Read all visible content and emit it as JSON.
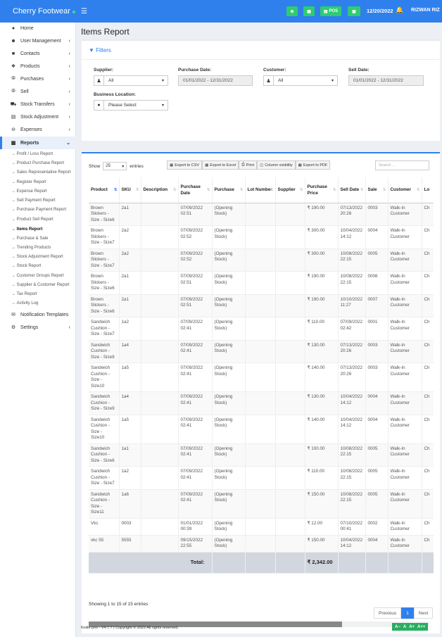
{
  "app": {
    "brand": "Cherry Footwear"
  },
  "topbar": {
    "pos_label": "POS",
    "date": "12/20/2022",
    "user": "RIZWAN RIZ"
  },
  "sidebar": {
    "items": [
      {
        "label": "Home",
        "icon": "dashboard-icon"
      },
      {
        "label": "User Management",
        "icon": "users-icon"
      },
      {
        "label": "Contacts",
        "icon": "address-book-icon"
      },
      {
        "label": "Products",
        "icon": "cubes-icon"
      },
      {
        "label": "Purchases",
        "icon": "arrow-circle-down-icon"
      },
      {
        "label": "Sell",
        "icon": "arrow-circle-up-icon"
      },
      {
        "label": "Stock Transfers",
        "icon": "truck-icon"
      },
      {
        "label": "Stock Adjustment",
        "icon": "database-icon"
      },
      {
        "label": "Expenses",
        "icon": "minus-circle-icon"
      },
      {
        "label": "Reports",
        "icon": "bar-chart-icon"
      }
    ],
    "sub_items": [
      "Profit / Loss Report",
      "Product Purchase Report",
      "Sales Representative Report",
      "Register Report",
      "Expense Report",
      "Sell Payment Report",
      "Purchase Payment Report",
      "Product Sell Report",
      "Items Report",
      "Purchase & Sale",
      "Trending Products",
      "Stock Adjustment Report",
      "Stock Report",
      "Customer Groups Report",
      "Supplier & Customer Report",
      "Tax Report",
      "Activity Log"
    ],
    "bottom_items": [
      {
        "label": "Notification Templates",
        "icon": "envelope-icon"
      },
      {
        "label": "Settings",
        "icon": "cog-icon"
      }
    ]
  },
  "page": {
    "title": "Items Report"
  },
  "filters": {
    "title": "Filters",
    "supplier_label": "Supplier:",
    "supplier_value": "All",
    "purchase_date_label": "Purchase Date:",
    "purchase_date_value": "01/01/2022 - 12/31/2022",
    "customer_label": "Customer:",
    "customer_value": "All",
    "sell_date_label": "Sell Date:",
    "sell_date_value": "01/01/2022 - 12/31/2022",
    "location_label": "Business Location:",
    "location_value": "Please Select"
  },
  "table": {
    "show_label": "Show",
    "entries_value": "25",
    "entries_label": "entries",
    "export_csv": "Export to CSV",
    "export_excel": "Export to Excel",
    "print": "Print",
    "column_visibility": "Column visibility",
    "export_pdf": "Export to PDF",
    "search_placeholder": "Search ...",
    "columns": [
      "Product",
      "SKU",
      "Description",
      "Purchase Date",
      "Purchase",
      "Lot Number",
      "Supplier",
      "Purchase Price",
      "Sell Date",
      "Sale",
      "Customer",
      "Lo"
    ],
    "rows": [
      [
        "Brown Slickers - Size - Size6",
        "2a1",
        "",
        "07/09/2022 02:51",
        "(Opening Stock)",
        "",
        "",
        "₹ 190.00",
        "07/13/2022 20:26",
        "0003",
        "Walk-In Customer",
        "Ch"
      ],
      [
        "Brown Slickers - Size - Size7",
        "2a2",
        "",
        "07/09/2022 02:52",
        "(Opening Stock)",
        "",
        "",
        "₹ 300.00",
        "10/04/2022 14:12",
        "0004",
        "Walk-In Customer",
        "Ch"
      ],
      [
        "Brown Slickers - Size - Size7",
        "2a2",
        "",
        "07/09/2022 02:52",
        "(Opening Stock)",
        "",
        "",
        "₹ 300.00",
        "10/08/2022 22:15",
        "0005",
        "Walk-In Customer",
        "Ch"
      ],
      [
        "Brown Slickers - Size - Size6",
        "2a1",
        "",
        "07/09/2022 02:51",
        "(Opening Stock)",
        "",
        "",
        "₹ 190.00",
        "10/08/2022 22:15",
        "0006",
        "Walk-In Customer",
        "Ch"
      ],
      [
        "Brown Slickers - Size - Size6",
        "2a1",
        "",
        "07/09/2022 02:51",
        "(Opening Stock)",
        "",
        "",
        "₹ 190.00",
        "10/10/2022 11:27",
        "0007",
        "Walk-In Customer",
        "Ch"
      ],
      [
        "Sandwich Cushion - Size - Size7",
        "1a2",
        "",
        "07/09/2022 02:41",
        "(Opening Stock)",
        "",
        "",
        "₹ 110.00",
        "07/09/2022 02:42",
        "0001",
        "Walk-In Customer",
        "Ch"
      ],
      [
        "Sandwich Cushion - Size - Size9",
        "1a4",
        "",
        "07/09/2022 02:41",
        "(Opening Stock)",
        "",
        "",
        "₹ 130.00",
        "07/13/2022 20:26",
        "0003",
        "Walk-In Customer",
        "Ch"
      ],
      [
        "Sandwich Cushion - Size - Size10",
        "1a5",
        "",
        "07/09/2022 02:41",
        "(Opening Stock)",
        "",
        "",
        "₹ 140.00",
        "07/13/2022 20:26",
        "0003",
        "Walk-In Customer",
        "Ch"
      ],
      [
        "Sandwich Cushion - Size - Size9",
        "1a4",
        "",
        "07/09/2022 02:41",
        "(Opening Stock)",
        "",
        "",
        "₹ 130.00",
        "10/04/2022 14:12",
        "0004",
        "Walk-In Customer",
        "Ch"
      ],
      [
        "Sandwich Cushion - Size - Size10",
        "1a5",
        "",
        "07/09/2022 02:41",
        "(Opening Stock)",
        "",
        "",
        "₹ 140.00",
        "10/04/2022 14:12",
        "0004",
        "Walk-In Customer",
        "Ch"
      ],
      [
        "Sandwich Cushion - Size - Size6",
        "1a1",
        "",
        "07/09/2022 02:41",
        "(Opening Stock)",
        "",
        "",
        "₹ 100.00",
        "10/08/2022 22:15",
        "0005",
        "Walk-In Customer",
        "Ch"
      ],
      [
        "Sandwich Cushion - Size - Size7",
        "1a2",
        "",
        "07/09/2022 02:41",
        "(Opening Stock)",
        "",
        "",
        "₹ 110.00",
        "10/08/2022 22:15",
        "0005",
        "Walk-In Customer",
        "Ch"
      ],
      [
        "Sandwich Cushion - Size - Size11",
        "1a6",
        "",
        "07/09/2022 02:41",
        "(Opening Stock)",
        "",
        "",
        "₹ 150.00",
        "10/08/2022 22:15",
        "0005",
        "Walk-In Customer",
        "Ch"
      ],
      [
        "Vkc",
        "0003",
        "",
        "01/01/2022 00:39",
        "(Opening Stock)",
        "",
        "",
        "₹ 12.00",
        "07/10/2022 00:41",
        "0002",
        "Walk-In Customer",
        "Ch"
      ],
      [
        "vkc 55",
        "5555",
        "",
        "09/15/2022 22:55",
        "(Opening Stock)",
        "",
        "",
        "₹ 150.00",
        "10/04/2022 14:12",
        "0004",
        "Walk-In Customer",
        "Ch"
      ]
    ],
    "total_label": "Total:",
    "total_value": "₹ 2,342.00",
    "info": "Showing 1 to 15 of 15 entries",
    "prev_label": "Previous",
    "page_number": "1",
    "next_label": "Next"
  },
  "footer": {
    "text": "footie pos - V4.7.7 | Copyright © 2022 All rights reserved."
  },
  "accessibility": {
    "a_minus": "A−",
    "a": "A",
    "a_plus": "A+",
    "a_plus_plus": "A++"
  }
}
